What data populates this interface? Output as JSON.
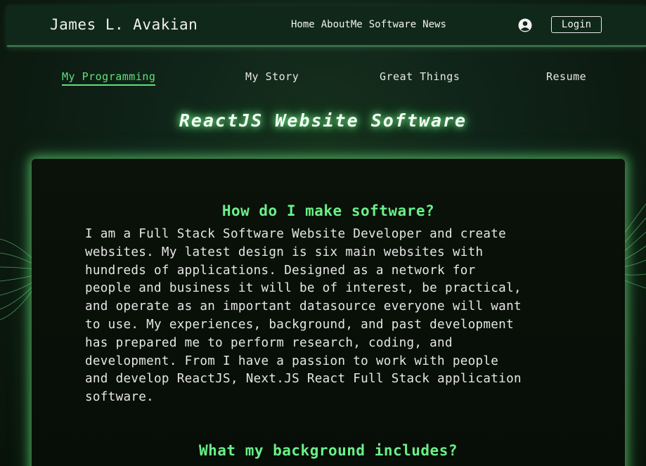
{
  "header": {
    "brand": "James L. Avakian",
    "nav": [
      "Home",
      "AboutMe",
      "Software",
      "News"
    ],
    "user_icon": "user-circle-icon",
    "login_label": "Login"
  },
  "subnav": {
    "items": [
      "My Programming",
      "My Story",
      "Great Things",
      "Resume"
    ],
    "active_index": 0
  },
  "page_title": "ReactJS Website Software",
  "content": {
    "heading1": "How do I make software?",
    "paragraph1_lines": [
      "I am a Full Stack Software Website Developer and create",
      "websites. My latest design is six main websites with",
      "hundreds of applications. Designed as a network for",
      "people and business it will be of interest, be practical,",
      "and operate as an important datasource everyone will want",
      "to use. My experiences, background, and past development",
      "has prepared me to perform research, coding, and",
      "development. From I have a passion to work with people",
      "and develop ReactJS, Next.JS React Full Stack application",
      "software."
    ],
    "heading2": "What my background includes?"
  },
  "colors": {
    "accent": "#5fe07a",
    "heading": "#6af089",
    "background": "#0c1a0f"
  }
}
